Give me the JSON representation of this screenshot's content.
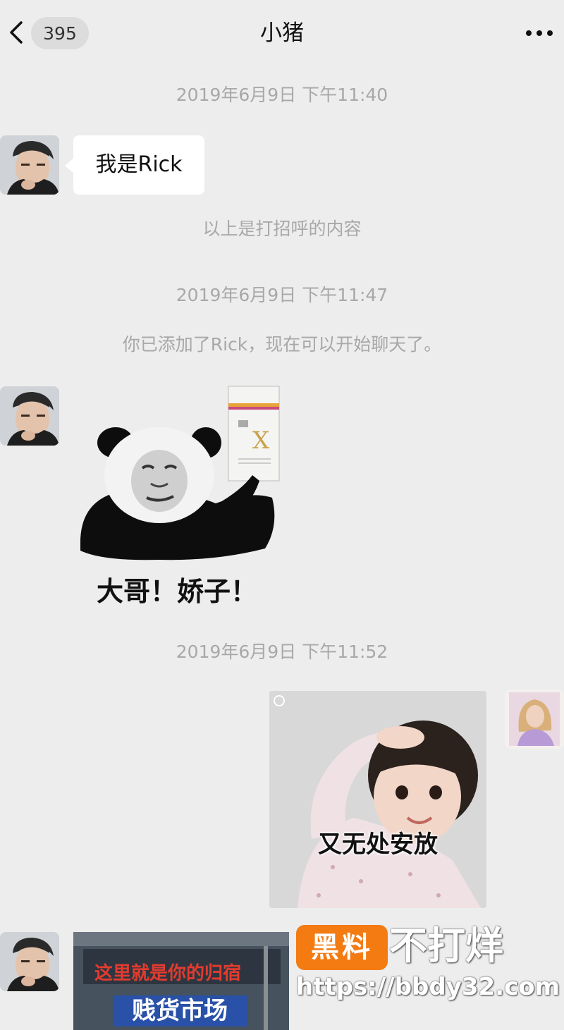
{
  "header": {
    "back_icon": "chevron-left-icon",
    "unread_count": "395",
    "title": "小猪",
    "more_icon": "more-dots-icon"
  },
  "messages": {
    "timestamp_1": "2019年6月9日 下午11:40",
    "greeting_text": "我是Rick",
    "greeting_note": "以上是打招呼的内容",
    "timestamp_2": "2019年6月9日 下午11:47",
    "added_notice": "你已添加了Rick，现在可以开始聊天了。",
    "sticker_1_caption": "大哥！娇子！",
    "timestamp_3": "2019年6月9日 下午11:52",
    "sticker_2_caption": "又无处安放",
    "image_3_text_1": "这里就是你的归宿",
    "image_3_text_2": "贱货市场"
  },
  "watermark": {
    "badge": "黑料",
    "text": "不打烊",
    "url": "https://bbdy32.com"
  },
  "colors": {
    "background": "#ededed",
    "bubble": "#ffffff",
    "system_text": "#a8a8a8",
    "watermark_orange": "#f47a12"
  }
}
